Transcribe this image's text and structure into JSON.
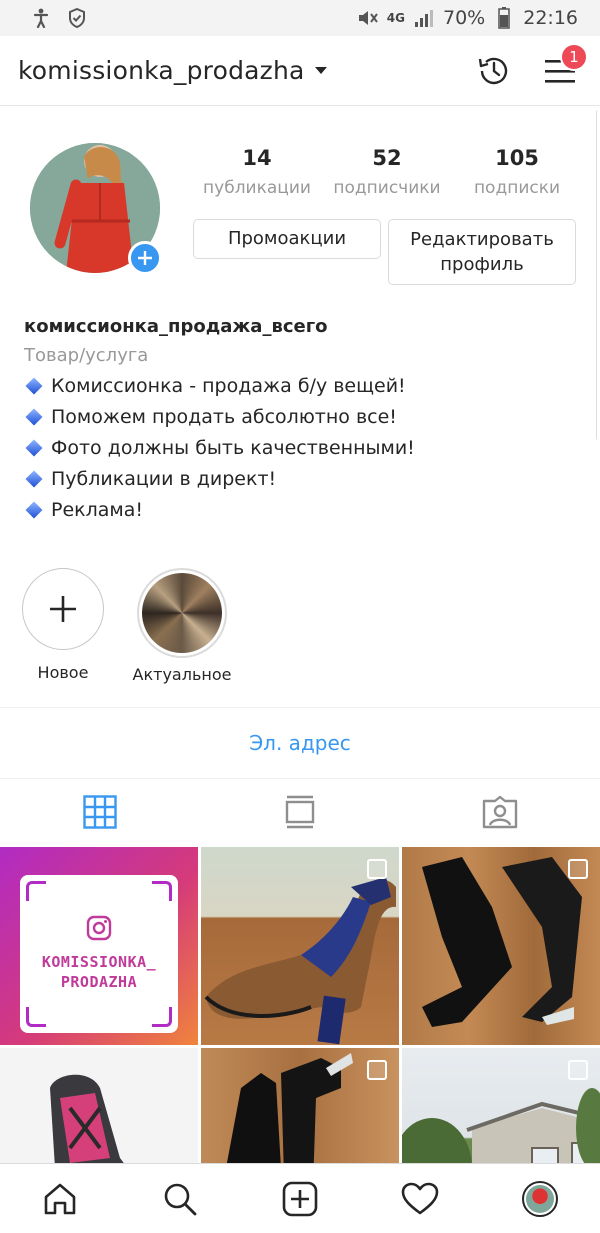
{
  "statusbar": {
    "network": "4G",
    "battery": "70%",
    "time": "22:16"
  },
  "header": {
    "username": "komissionka_prodazha",
    "notifications_count": "1"
  },
  "profile": {
    "stats": [
      {
        "value": "14",
        "label": "публикации"
      },
      {
        "value": "52",
        "label": "подписчики"
      },
      {
        "value": "105",
        "label": "подписки"
      }
    ],
    "promo_button": "Промоакции",
    "edit_button": "Редактировать профиль"
  },
  "bio": {
    "name": "комиссионка_продажа_всего",
    "category": "Товар/услуга",
    "lines": [
      "Комиссионка - продажа б/у  вещей!",
      "Поможем продать абсолютно все!",
      "Фото должны быть качественными!",
      "Публикации в директ!",
      "Реклама!"
    ]
  },
  "highlights": [
    {
      "label": "Новое"
    },
    {
      "label": "Актуальное"
    }
  ],
  "email_link": "Эл. адрес",
  "nametag": {
    "line1": "KOMISSIONKA_",
    "line2": "PRODAZHA"
  },
  "colors": {
    "link": "#3897f0",
    "badge": "#ed4956",
    "accent": "#b12bc4"
  },
  "icons": {
    "tabs": [
      "grid-icon",
      "feed-icon",
      "tagged-icon"
    ],
    "bottom_nav": [
      "home-icon",
      "search-icon",
      "add-post-icon",
      "heart-icon",
      "profile-avatar"
    ]
  }
}
